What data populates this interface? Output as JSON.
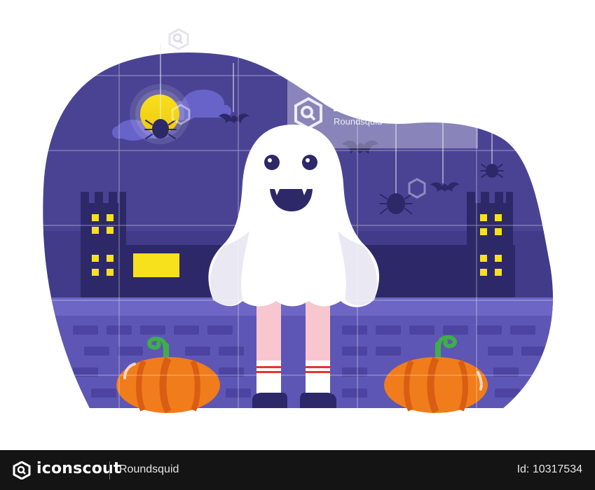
{
  "scene": {
    "colors": {
      "sky": "#4a4394",
      "sky_dark": "#3f3a85",
      "building": "#2d2969",
      "window": "#f7e11c",
      "wall": "#5e56b5",
      "wall_top": "#6d66c4",
      "brick": "#4c44a0",
      "moon": "#f7e11c",
      "ghost": "#ffffff",
      "ghost_shadow": "#e5e4f0",
      "pumpkin": "#f07c1b",
      "pumpkin_dark": "#d95d12",
      "stem": "#3fae49",
      "leg": "#f8c6cf",
      "shoe": "#2d2969",
      "spider": "#2d2969",
      "cloud": "#6763c9"
    },
    "elements": {
      "moon": "moon",
      "ghost": "ghost-costume",
      "spiders": "hanging-spiders",
      "bats": "flying-bats",
      "pumpkins": "pumpkins",
      "castle_towers": "castle-towers"
    }
  },
  "watermark": {
    "brand": "iconscout",
    "author": "Roundsquid"
  },
  "footer": {
    "brand": "iconscout",
    "author": "Roundsquid",
    "asset_id": "Id: 10317534"
  }
}
